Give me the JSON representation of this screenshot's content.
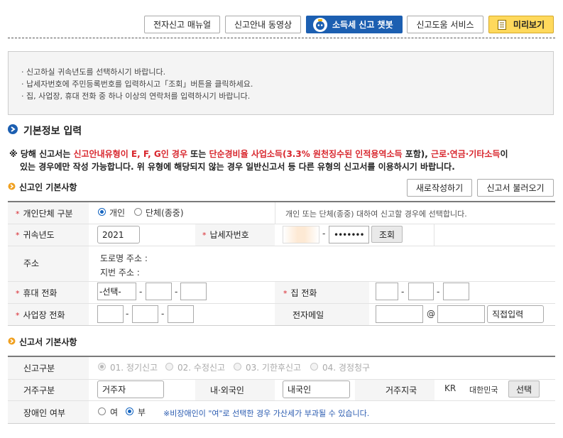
{
  "toolbar": {
    "manual": "전자신고 매뉴얼",
    "video": "신고안내 동영상",
    "chatbot": "소득세 신고 챗봇",
    "help_service": "신고도움 서비스",
    "preview": "미리보기"
  },
  "notice": {
    "items": [
      "신고하실 귀속년도를 선택하시기 바랍니다.",
      "납세자번호에 주민등록번호를 입력하시고「조회」버튼을 클릭하세요.",
      "집, 사업장, 휴대 전화 중 하나 이상의 연락처를 입력하시기 바랍니다."
    ]
  },
  "basic": {
    "title": "기본정보 입력",
    "warn_prefix": "※ 당해 신고서는 ",
    "warn_red1": "신고안내유형이 E, F, G인 경우",
    "warn_mid1": " 또는 ",
    "warn_red2": "단순경비율 사업소득(3.3% 원천징수된 인적용역소득",
    "warn_mid2": " 포함), ",
    "warn_red3": "근로·연금·기타소득",
    "warn_suffix": "이",
    "warn_line2": "있는 경우에만 작성 가능합니다. 위 유형에 해당되지 않는 경우 일반신고서 등 다른 유형의 신고서를 이용하시기 바랍니다."
  },
  "filer": {
    "title": "신고인 기본사항",
    "new_button": "새로작성하기",
    "load_button": "신고서 불러오기",
    "type_label": "개인단체 구분",
    "type_individual": "개인",
    "type_group": "단체(종중)",
    "type_help": "개인 또는 단체(종중) 대하여 신고할 경우에 선택합니다.",
    "year_label": "귀속년도",
    "year_value": "2021",
    "taxpayer_label": "납세자번호",
    "taxpayer_mask": "•••••••",
    "lookup_button": "조회",
    "address_label": "주소",
    "road_address": "도로명 주소 :",
    "lot_address": "지번 주소 :",
    "mobile_label": "휴대 전화",
    "mobile_select": "-선택-",
    "home_label": "집 전화",
    "office_label": "사업장 전화",
    "email_label": "전자메일",
    "email_at": "@",
    "email_domain_select": "직접입력"
  },
  "report": {
    "title": "신고서 기본사항",
    "category_label": "신고구분",
    "cat_options": [
      "01. 정기신고",
      "02. 수정신고",
      "03. 기한후신고",
      "04. 경정청구"
    ],
    "residence_label": "거주구분",
    "residence_value": "거주자",
    "nationality_label": "내·외국인",
    "nationality_value": "내국인",
    "country_label": "거주지국",
    "country_code": "KR",
    "country_name": "대한민국",
    "select_button": "선택",
    "disability_label": "장애인 여부",
    "yes": "여",
    "no": "부",
    "disability_note": "※비장애인이 \"여\"로 선택한 경우 가산세가 부과될 수 있습니다."
  },
  "colors": {
    "accent_blue": "#1c5fb1",
    "required_red": "#d8262d",
    "preview_yellow": "#ffd95c"
  }
}
